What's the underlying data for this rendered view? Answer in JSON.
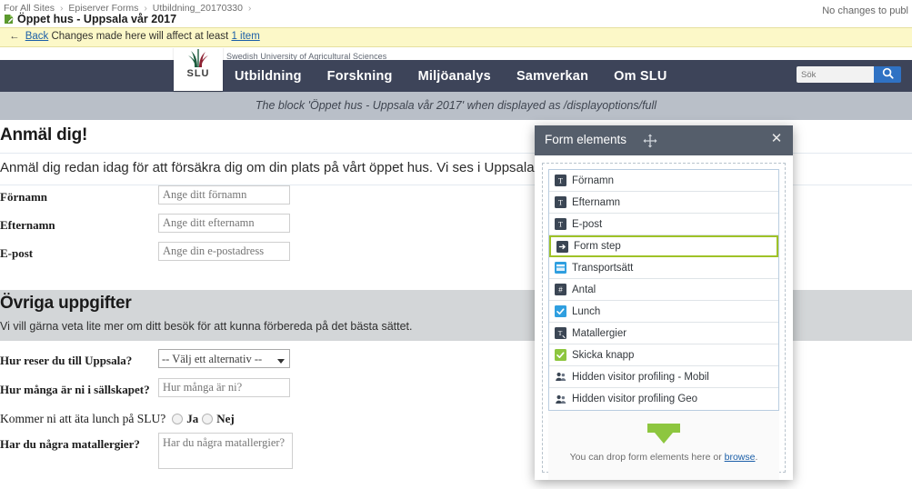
{
  "cms": {
    "breadcrumb": [
      "For All Sites",
      "Episerver Forms",
      "Utbildning_20170330"
    ],
    "page_title": "Öppet hus - Uppsala vår 2017",
    "publish_status": "No changes to publ",
    "notice": {
      "back_label": "Back",
      "text": "Changes made here will affect at least",
      "link_label": "1 item"
    }
  },
  "site": {
    "university_name": "Swedish University of Agricultural Sciences",
    "logo_text": "SLU",
    "nav": [
      "Utbildning",
      "Forskning",
      "Miljöanalys",
      "Samverkan",
      "Om SLU"
    ],
    "search": {
      "placeholder": "Sök",
      "icon": "search-icon"
    },
    "display_note": "The block 'Öppet hus - Uppsala vår 2017' when displayed as /displayoptions/full"
  },
  "form": {
    "section1": {
      "heading": "Anmäl dig!",
      "intro": "Anmäl dig redan idag för att försäkra dig om din plats på vårt öppet hus. Vi ses i Uppsala!",
      "fields": [
        {
          "label": "Förnamn",
          "placeholder": "Ange ditt förnamn",
          "type": "text"
        },
        {
          "label": "Efternamn",
          "placeholder": "Ange ditt efternamn",
          "type": "text"
        },
        {
          "label": "E-post",
          "placeholder": "Ange din e-postadress",
          "type": "text"
        }
      ]
    },
    "section2": {
      "heading": "Övriga uppgifter",
      "intro": "Vi vill gärna veta lite mer om ditt besök för att kunna förbereda på det bästa sättet.",
      "travel": {
        "label": "Hur reser du till Uppsala?",
        "selected": "-- Välj ett alternativ --"
      },
      "party": {
        "label": "Hur många är ni i sällskapet?",
        "placeholder": "Hur många är ni?"
      },
      "lunch": {
        "label": "Kommer ni att äta lunch på SLU?",
        "options": [
          "Ja",
          "Nej"
        ]
      },
      "allergies": {
        "label": "Har du några matallergier?",
        "placeholder": "Har du några matallergier?"
      }
    }
  },
  "dialog": {
    "title": "Form elements",
    "move_icon": "move-icon",
    "close_icon": "close-icon",
    "elements": [
      {
        "label": "Förnamn",
        "icon": "text-field-icon",
        "selected": false
      },
      {
        "label": "Efternamn",
        "icon": "text-field-icon",
        "selected": false
      },
      {
        "label": "E-post",
        "icon": "text-field-icon",
        "selected": false
      },
      {
        "label": "Form step",
        "icon": "form-step-icon",
        "selected": true
      },
      {
        "label": "Transportsätt",
        "icon": "select-field-icon",
        "selected": false
      },
      {
        "label": "Antal",
        "icon": "number-field-icon",
        "selected": false
      },
      {
        "label": "Lunch",
        "icon": "checkbox-field-icon",
        "selected": false
      },
      {
        "label": "Matallergier",
        "icon": "textarea-field-icon",
        "selected": false
      },
      {
        "label": "Skicka knapp",
        "icon": "submit-button-icon",
        "selected": false
      },
      {
        "label": "Hidden visitor profiling - Mobil",
        "icon": "visitor-profiling-icon",
        "selected": false
      },
      {
        "label": "Hidden visitor profiling Geo",
        "icon": "visitor-profiling-icon",
        "selected": false
      }
    ],
    "dropzone": {
      "icon": "drop-arrow-icon",
      "text_before": "You can drop form elements here or",
      "link_label": "browse",
      "text_after": "."
    }
  },
  "colors": {
    "nav_bg": "#3d4459",
    "notice_bg": "#fcf8c8",
    "dialog_header": "#555e6b",
    "accent_green": "#9fc228",
    "search_button": "#2f72c4",
    "grey_band": "#d3d6d8"
  }
}
